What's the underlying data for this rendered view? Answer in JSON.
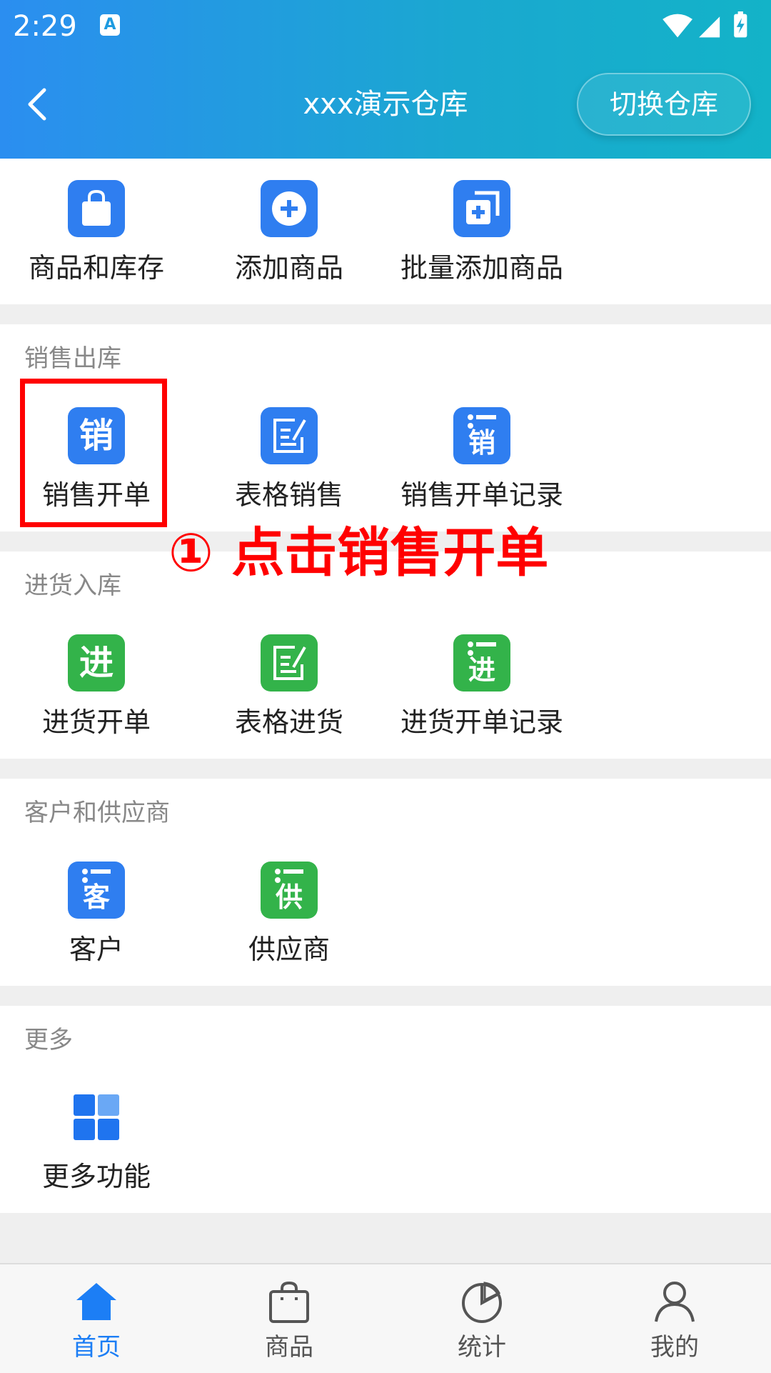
{
  "status_bar": {
    "time": "2:29",
    "notif_icon": "A"
  },
  "header": {
    "title": "xxx演示仓库",
    "switch_label": "切换仓库"
  },
  "top_items": [
    {
      "label": "商品和库存",
      "icon": "shopping-bag-icon"
    },
    {
      "label": "添加商品",
      "icon": "plus-circle-icon"
    },
    {
      "label": "批量添加商品",
      "icon": "batch-add-icon"
    }
  ],
  "sales": {
    "title": "销售出库",
    "items": [
      {
        "label": "销售开单",
        "glyph": "销"
      },
      {
        "label": "表格销售",
        "icon": "edit-form-icon"
      },
      {
        "label": "销售开单记录",
        "glyph": "销"
      }
    ]
  },
  "purchase": {
    "title": "进货入库",
    "items": [
      {
        "label": "进货开单",
        "glyph": "进"
      },
      {
        "label": "表格进货",
        "icon": "edit-form-icon"
      },
      {
        "label": "进货开单记录",
        "glyph": "进"
      }
    ]
  },
  "partners": {
    "title": "客户和供应商",
    "items": [
      {
        "label": "客户",
        "glyph": "客"
      },
      {
        "label": "供应商",
        "glyph": "供"
      }
    ]
  },
  "more": {
    "title": "更多",
    "items": [
      {
        "label": "更多功能",
        "icon": "grid-icon"
      }
    ]
  },
  "annotation": "① 点击销售开单",
  "tabbar": [
    {
      "label": "首页",
      "icon": "home-icon",
      "active": true
    },
    {
      "label": "商品",
      "icon": "bag-icon"
    },
    {
      "label": "统计",
      "icon": "pie-chart-icon"
    },
    {
      "label": "我的",
      "icon": "user-icon"
    }
  ],
  "colors": {
    "accent_blue": "#2f7ef0",
    "accent_green": "#33b34a",
    "tab_active": "#1c7ef5",
    "annotation_red": "#ff0000"
  }
}
